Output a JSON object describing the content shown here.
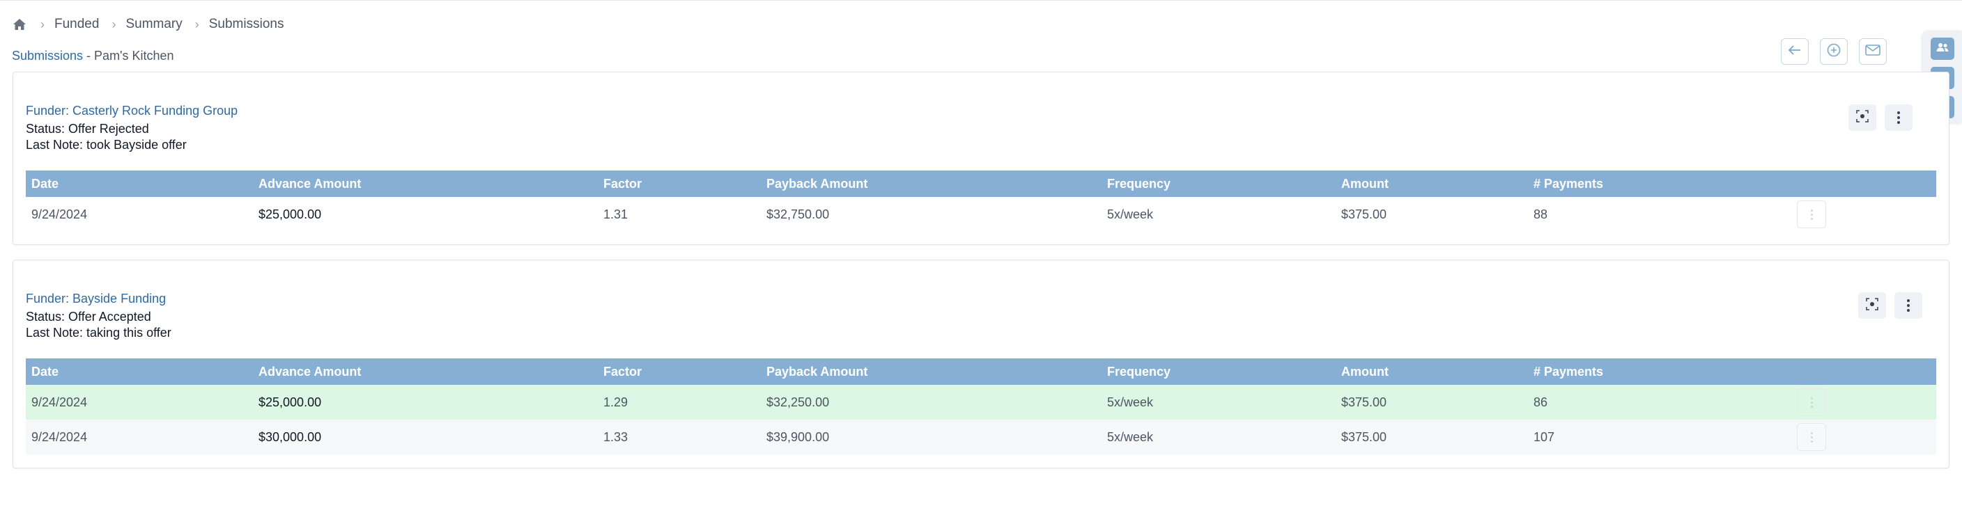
{
  "breadcrumb": {
    "home_icon": "home-icon",
    "items": [
      "Funded",
      "Summary",
      "Submissions"
    ]
  },
  "heading": {
    "link": "Submissions",
    "separator": " - ",
    "merchant": "Pam's Kitchen"
  },
  "toolbar": {
    "icons": [
      "arrow-left-icon",
      "plus-circle-icon",
      "mail-icon"
    ]
  },
  "rail": {
    "icons": [
      "contacts-icon",
      "folder-icon",
      "bookmark-icon"
    ]
  },
  "table": {
    "columns": [
      "Date",
      "Advance Amount",
      "Factor",
      "Payback Amount",
      "Frequency",
      "Amount",
      "# Payments"
    ]
  },
  "submissions": [
    {
      "funder": "Funder: Casterly Rock Funding Group",
      "status": "Status: Offer Rejected",
      "note": "Last Note: took Bayside offer",
      "offers": [
        {
          "date": "9/24/2024",
          "advance": "$25,000.00",
          "factor": "1.31",
          "payback": "$32,750.00",
          "frequency": "5x/week",
          "amount": "$375.00",
          "payments": "88"
        }
      ]
    },
    {
      "funder": "Funder: Bayside Funding",
      "status": "Status: Offer Accepted",
      "note": "Last Note: taking this offer",
      "offers": [
        {
          "date": "9/24/2024",
          "advance": "$25,000.00",
          "factor": "1.29",
          "payback": "$32,250.00",
          "frequency": "5x/week",
          "amount": "$375.00",
          "payments": "86",
          "accepted": true
        },
        {
          "date": "9/24/2024",
          "advance": "$30,000.00",
          "factor": "1.33",
          "payback": "$39,900.00",
          "frequency": "5x/week",
          "amount": "$375.00",
          "payments": "107"
        }
      ]
    }
  ],
  "colors": {
    "link": "#2f6aa3",
    "table_header": "#86afd3",
    "accepted_row": "#dcf7e3",
    "rail_button": "#7fa7cc"
  }
}
